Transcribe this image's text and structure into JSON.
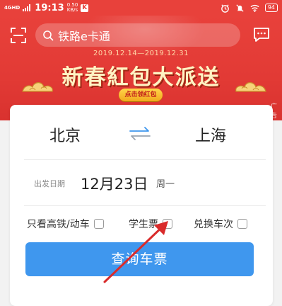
{
  "status_bar": {
    "network": "4GHD",
    "time": "19:13",
    "speed_value": "0.50",
    "speed_unit": "KB/s",
    "app_badge": "K",
    "battery": "94"
  },
  "banner": {
    "date_range": "2019.12.14—2019.12.31",
    "title": "新春紅包大派送",
    "button_label": "点击领红包",
    "ad_tag": "广告"
  },
  "search": {
    "placeholder": "铁路e卡通"
  },
  "route": {
    "from": "北京",
    "to": "上海"
  },
  "date": {
    "label": "出发日期",
    "value": "12月23日",
    "weekday": "周一"
  },
  "options": [
    {
      "label": "只看高铁/动车",
      "checked": false
    },
    {
      "label": "学生票",
      "checked": false
    },
    {
      "label": "兑换车次",
      "checked": false
    }
  ],
  "query_button": {
    "label": "查询车票"
  },
  "colors": {
    "banner_red": "#e8413b",
    "button_blue": "#3f97ee",
    "annotation_arrow": "#d92b2b"
  }
}
